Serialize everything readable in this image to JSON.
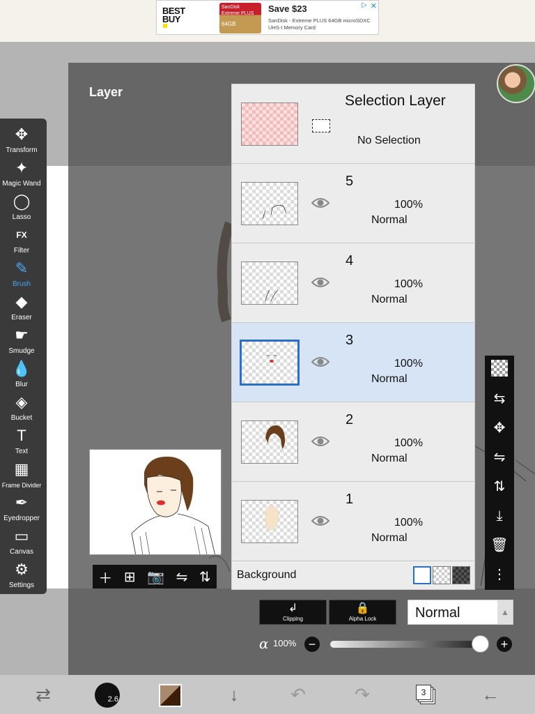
{
  "ad": {
    "brand": "BEST BUY",
    "card_brand": "SanDisk",
    "card_line": "Extreme PLUS",
    "card_size": "64GB",
    "headline": "Save $23",
    "description": "SanDisk - Extreme PLUS 64GB microSDXC UHS-I Memory Card"
  },
  "dialog": {
    "title": "Layer"
  },
  "tools": [
    {
      "label": "Transform",
      "icon": "move-icon",
      "glyph": "✥"
    },
    {
      "label": "Magic Wand",
      "icon": "magic-wand-icon",
      "glyph": "✦"
    },
    {
      "label": "Lasso",
      "icon": "lasso-icon",
      "glyph": "◯"
    },
    {
      "label": "Filter",
      "icon": "fx-icon",
      "glyph": "FX"
    },
    {
      "label": "Brush",
      "icon": "brush-icon",
      "glyph": "✎"
    },
    {
      "label": "Eraser",
      "icon": "eraser-icon",
      "glyph": "◆"
    },
    {
      "label": "Smudge",
      "icon": "smudge-icon",
      "glyph": "☛"
    },
    {
      "label": "Blur",
      "icon": "drop-icon",
      "glyph": "💧"
    },
    {
      "label": "Bucket",
      "icon": "bucket-icon",
      "glyph": "◈"
    },
    {
      "label": "Text",
      "icon": "text-icon",
      "glyph": "T"
    },
    {
      "label": "Frame Divider",
      "icon": "frame-divider-icon",
      "glyph": "▦"
    },
    {
      "label": "Eyedropper",
      "icon": "eyedropper-icon",
      "glyph": "✒"
    },
    {
      "label": "Canvas",
      "icon": "canvas-icon",
      "glyph": "▭"
    },
    {
      "label": "Settings",
      "icon": "gear-icon",
      "glyph": "⚙"
    }
  ],
  "selection_layer": {
    "title": "Selection Layer",
    "status": "No Selection"
  },
  "layers": [
    {
      "name": "5",
      "opacity": "100%",
      "blend": "Normal",
      "selected": false
    },
    {
      "name": "4",
      "opacity": "100%",
      "blend": "Normal",
      "selected": false
    },
    {
      "name": "3",
      "opacity": "100%",
      "blend": "Normal",
      "selected": true
    },
    {
      "name": "2",
      "opacity": "100%",
      "blend": "Normal",
      "selected": false
    },
    {
      "name": "1",
      "opacity": "100%",
      "blend": "Normal",
      "selected": false
    }
  ],
  "background": {
    "label": "Background"
  },
  "controls": {
    "clipping_label": "Clipping",
    "alpha_lock_label": "Alpha Lock",
    "blend_mode": "Normal",
    "alpha_symbol": "α",
    "alpha_value": "100%",
    "alpha_fraction": 1.0
  },
  "bottom": {
    "brush_size": "2.6",
    "layer_count": "3"
  },
  "colors": {
    "accent": "#4aa7f0",
    "selected_layer": "#d6e4f5",
    "selected_border": "#2d6ec9",
    "primary_color": "#3a1e0a",
    "secondary_color": "#a98a6e"
  }
}
